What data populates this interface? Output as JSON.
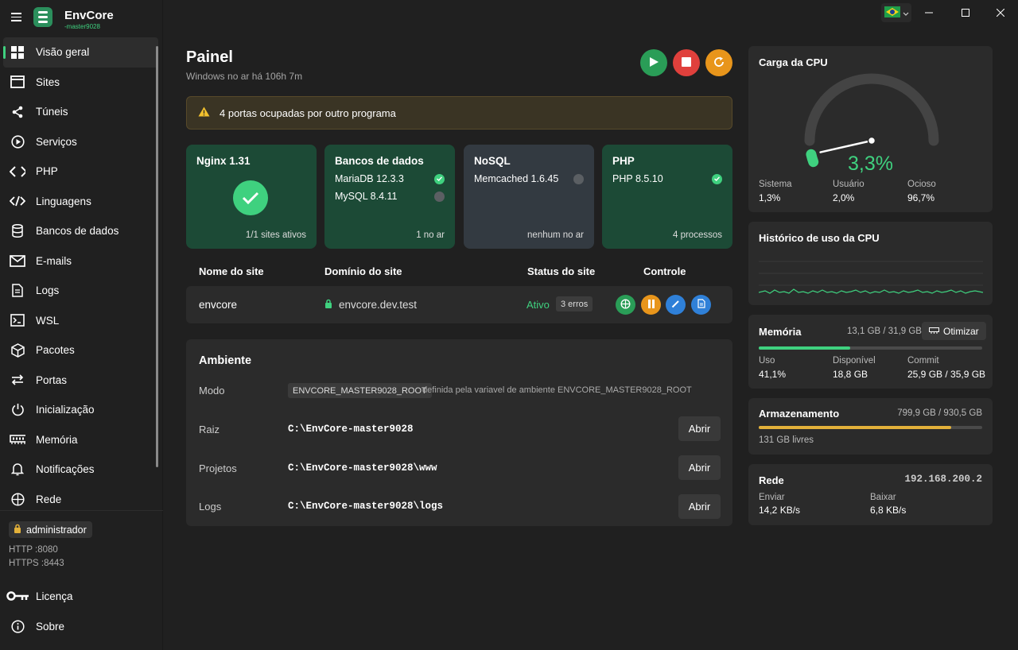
{
  "app": {
    "name": "EnvCore",
    "subtitle": "-master9028",
    "locale_flag": "Brazil flag"
  },
  "sidebar": {
    "items": [
      {
        "label": "Visão geral",
        "icon": "grid-icon",
        "active": true
      },
      {
        "label": "Sites",
        "icon": "window-icon"
      },
      {
        "label": "Túneis",
        "icon": "share-icon"
      },
      {
        "label": "Serviços",
        "icon": "play-circle-icon"
      },
      {
        "label": "PHP",
        "icon": "code-icon"
      },
      {
        "label": "Linguagens",
        "icon": "code-slash-icon"
      },
      {
        "label": "Bancos de dados",
        "icon": "database-icon"
      },
      {
        "label": "E-mails",
        "icon": "mail-icon"
      },
      {
        "label": "Logs",
        "icon": "document-icon"
      },
      {
        "label": "WSL",
        "icon": "terminal-icon"
      },
      {
        "label": "Pacotes",
        "icon": "package-icon"
      },
      {
        "label": "Portas",
        "icon": "arrows-icon"
      },
      {
        "label": "Inicialização",
        "icon": "power-icon"
      },
      {
        "label": "Memória",
        "icon": "memory-icon"
      },
      {
        "label": "Notificações",
        "icon": "bell-icon"
      },
      {
        "label": "Rede",
        "icon": "globe-icon"
      }
    ],
    "user": "administrador",
    "http": "HTTP :8080",
    "https": "HTTPS :8443",
    "license": "Licença",
    "about": "Sobre"
  },
  "main": {
    "title": "Painel",
    "uptime": "Windows no ar há 106h 7m",
    "warning": "4 portas ocupadas por outro programa"
  },
  "cards": {
    "nginx": {
      "title": "Nginx 1.31",
      "footer": "1/1 sites ativos"
    },
    "databases": {
      "title": "Bancos de dados",
      "rows": [
        {
          "name": "MariaDB 12.3.3",
          "status": "ok"
        },
        {
          "name": "MySQL 8.4.11",
          "status": "off"
        }
      ],
      "footer": "1 no ar"
    },
    "nosql": {
      "title": "NoSQL",
      "rows": [
        {
          "name": "Memcached 1.6.45",
          "status": "off"
        }
      ],
      "footer": "nenhum no ar"
    },
    "php": {
      "title": "PHP",
      "rows": [
        {
          "name": "PHP 8.5.10",
          "status": "ok"
        }
      ],
      "footer": "4 processos"
    }
  },
  "sites_table": {
    "headers": {
      "name": "Nome do site",
      "domain": "Domínio do site",
      "status": "Status do site",
      "control": "Controle"
    },
    "rows": [
      {
        "name": "envcore",
        "domain": "envcore.dev.test",
        "status": "Ativo",
        "errors": "3 erros"
      }
    ]
  },
  "environment": {
    "title": "Ambiente",
    "mode_label": "Modo",
    "mode_value": "ENVCORE_MASTER9028_ROOT",
    "mode_desc": "definida pela variavel de ambiente ENVCORE_MASTER9028_ROOT",
    "paths": [
      {
        "label": "Raiz",
        "value": "C:\\EnvCore-master9028",
        "button": "Abrir"
      },
      {
        "label": "Projetos",
        "value": "C:\\EnvCore-master9028\\www",
        "button": "Abrir"
      },
      {
        "label": "Logs",
        "value": "C:\\EnvCore-master9028\\logs",
        "button": "Abrir"
      }
    ]
  },
  "cpu": {
    "title": "Carga da CPU",
    "value": "3,3%",
    "load_fraction": 0.033,
    "system_label": "Sistema",
    "system_value": "1,3%",
    "user_label": "Usuário",
    "user_value": "2,0%",
    "idle_label": "Ocioso",
    "idle_value": "96,7%"
  },
  "cpu_history": {
    "title": "Histórico de uso da CPU"
  },
  "memory": {
    "title": "Memória",
    "summary": "13,1 GB / 31,9 GB",
    "optimize": "Otimizar",
    "used_fraction": 0.41,
    "use_label": "Uso",
    "use_value": "41,1%",
    "avail_label": "Disponível",
    "avail_value": "18,8 GB",
    "commit_label": "Commit",
    "commit_value": "25,9 GB / 35,9 GB"
  },
  "storage": {
    "title": "Armazenamento",
    "summary": "799,9 GB / 930,5 GB",
    "used_fraction": 0.86,
    "free": "131 GB livres"
  },
  "network": {
    "title": "Rede",
    "ip": "192.168.200.2",
    "send_label": "Enviar",
    "send_value": "14,2 KB/s",
    "recv_label": "Baixar",
    "recv_value": "6,8 KB/s"
  },
  "colors": {
    "accent": "#3fd17f",
    "card_green": "#1c4a36",
    "card_gray": "#333a41",
    "stop": "#e0403c",
    "restart": "#e8951b",
    "edit": "#2f80d8",
    "storage_bar": "#e3b13a"
  }
}
